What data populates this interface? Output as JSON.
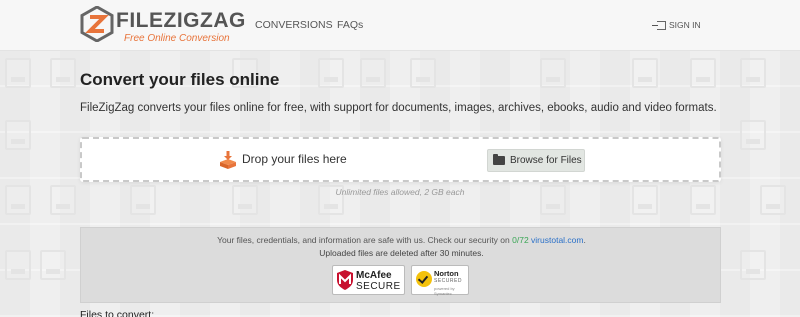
{
  "header": {
    "logo_text_file": "FILE",
    "logo_text_zigzag": "ZIGZAG",
    "tagline": "Free Online Conversion",
    "nav": [
      {
        "label": "CONVERSIONS"
      },
      {
        "label": "FAQs"
      }
    ],
    "sign_in_label": "SIGN IN"
  },
  "main": {
    "title": "Convert your files online",
    "intro": "FileZigZag converts your files online for free, with support for documents, images, archives, ebooks, audio and video formats.",
    "dropzone": {
      "label": "Drop your files here",
      "browse_label": "Browse for Files",
      "limits": "Unlimited files allowed, 2 GB each"
    },
    "security": {
      "text_before": "Your files, credentials, and information are safe with us. Check our security on ",
      "ratio": "0/72",
      "link": "virustotal.com",
      "text_after": ".",
      "deleted_notice": "Uploaded files are deleted after 30 minutes.",
      "mcafee_name": "McAfee",
      "mcafee_secure": "SECURE",
      "norton_name": "Norton",
      "norton_secured": "SECURED",
      "norton_by": "powered by Symantec"
    },
    "files_heading": "Files to convert:"
  },
  "colors": {
    "accent_orange": "#e8743b",
    "virustotal_green": "#3aa655",
    "link_blue": "#2a70c8"
  },
  "icons": [
    "zigzag-logo-icon",
    "sign-in-icon",
    "download-box-icon",
    "folder-icon",
    "mcafee-shield-icon",
    "norton-check-icon"
  ]
}
